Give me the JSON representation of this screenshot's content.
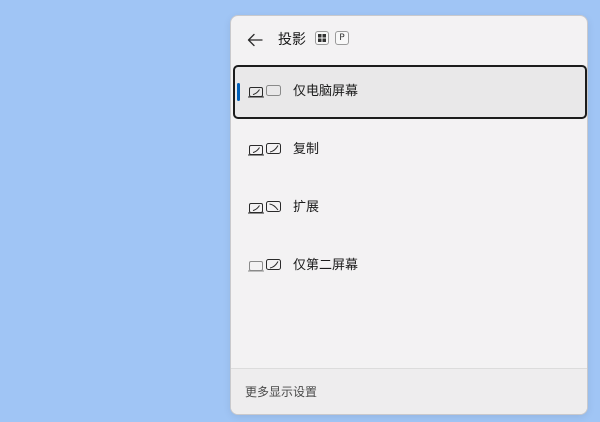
{
  "panel": {
    "title": "投影",
    "shortcut_keys": {
      "win": "win-logo-icon",
      "p": "P"
    },
    "back_icon": "back-arrow-icon"
  },
  "options": [
    {
      "label": "仅电脑屏幕",
      "icon": "pc-screen-only-icon",
      "selected": true
    },
    {
      "label": "复制",
      "icon": "duplicate-icon",
      "selected": false
    },
    {
      "label": "扩展",
      "icon": "extend-icon",
      "selected": false
    },
    {
      "label": "仅第二屏幕",
      "icon": "second-screen-only-icon",
      "selected": false
    }
  ],
  "footer": {
    "link": "更多显示设置"
  },
  "colors": {
    "desktop": "#a0c5f5",
    "panel": "#f3f2f3",
    "accent": "#005fb8",
    "selected_bg": "#e9e8e9"
  }
}
